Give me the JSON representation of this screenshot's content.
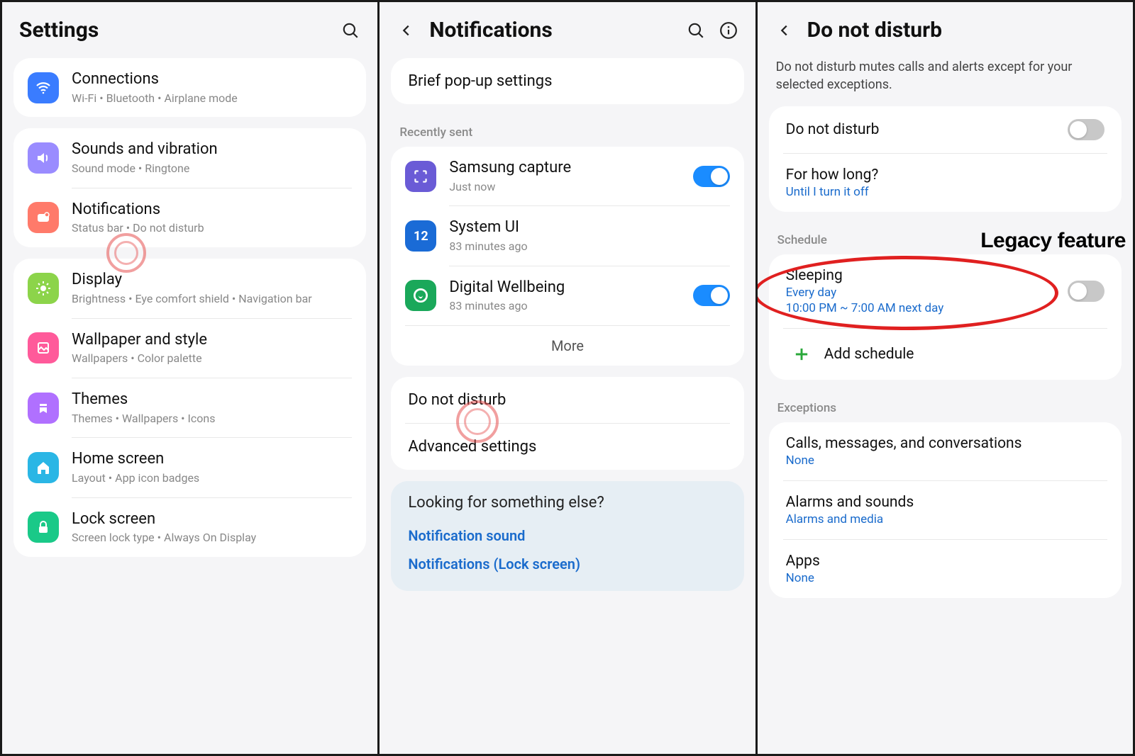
{
  "panel1": {
    "title": "Settings",
    "groups": [
      [
        {
          "title": "Connections",
          "sub": "Wi-Fi  •  Bluetooth  •  Airplane mode",
          "icon": "wifi",
          "bg": "#3a7cff"
        }
      ],
      [
        {
          "title": "Sounds and vibration",
          "sub": "Sound mode  •  Ringtone",
          "icon": "sound",
          "bg": "#9a8cff"
        },
        {
          "title": "Notifications",
          "sub": "Status bar  •  Do not disturb",
          "icon": "notif",
          "bg": "#ff7a6a"
        }
      ],
      [
        {
          "title": "Display",
          "sub": "Brightness  •  Eye comfort shield  •  Navigation bar",
          "icon": "display",
          "bg": "#8cd44a"
        },
        {
          "title": "Wallpaper and style",
          "sub": "Wallpapers  •  Color palette",
          "icon": "wallpaper",
          "bg": "#ff5a9a"
        },
        {
          "title": "Themes",
          "sub": "Themes  •  Wallpapers  •  Icons",
          "icon": "themes",
          "bg": "#b070ff"
        },
        {
          "title": "Home screen",
          "sub": "Layout  •  App icon badges",
          "icon": "home",
          "bg": "#2ab6e5"
        },
        {
          "title": "Lock screen",
          "sub": "Screen lock type  •  Always On Display",
          "icon": "lock",
          "bg": "#1ac988"
        }
      ]
    ]
  },
  "panel2": {
    "title": "Notifications",
    "brief": "Brief pop-up settings",
    "recently_label": "Recently sent",
    "recent": [
      {
        "title": "Samsung capture",
        "sub": "Just now",
        "icon": "capture",
        "bg": "#6a5bd6",
        "toggle": true
      },
      {
        "title": "System UI",
        "sub": "83 minutes ago",
        "icon": "sysui",
        "bg": "#1a6bd6",
        "toggle": null
      },
      {
        "title": "Digital Wellbeing",
        "sub": "83 minutes ago",
        "icon": "wellbeing",
        "bg": "#1aa85a",
        "toggle": true
      }
    ],
    "more": "More",
    "dnd": "Do not disturb",
    "advanced": "Advanced settings",
    "suggest_title": "Looking for something else?",
    "suggest_links": [
      "Notification sound",
      "Notifications (Lock screen)"
    ]
  },
  "panel3": {
    "title": "Do not disturb",
    "desc": "Do not disturb mutes calls and alerts except for your selected exceptions.",
    "dnd_label": "Do not disturb",
    "how_long": {
      "title": "For how long?",
      "sub": "Until I turn it off"
    },
    "schedule_label": "Schedule",
    "sleeping": {
      "title": "Sleeping",
      "sub1": "Every day",
      "sub2": "10:00 PM ~ 7:00 AM next day"
    },
    "add_schedule": "Add schedule",
    "exceptions_label": "Exceptions",
    "exceptions": [
      {
        "title": "Calls, messages, and conversations",
        "sub": "None"
      },
      {
        "title": "Alarms and sounds",
        "sub": "Alarms and media"
      },
      {
        "title": "Apps",
        "sub": "None"
      }
    ],
    "legacy": "Legacy feature"
  }
}
